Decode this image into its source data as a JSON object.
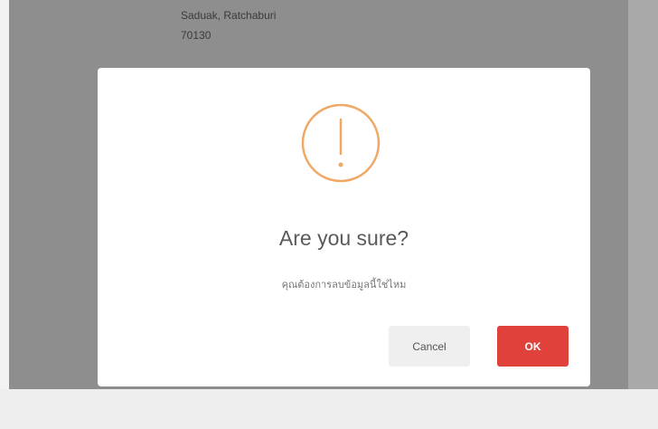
{
  "background": {
    "address_line1": "Saduak, Ratchaburi",
    "address_line2": "70130"
  },
  "dialog": {
    "icon": "warning-exclamation-icon",
    "icon_color": "#f0a866",
    "title": "Are you sure?",
    "text": "คุณต้องการลบข้อมูลนี้ใช่ไหม",
    "cancel_label": "Cancel",
    "ok_label": "OK",
    "ok_color": "#e0413b"
  }
}
